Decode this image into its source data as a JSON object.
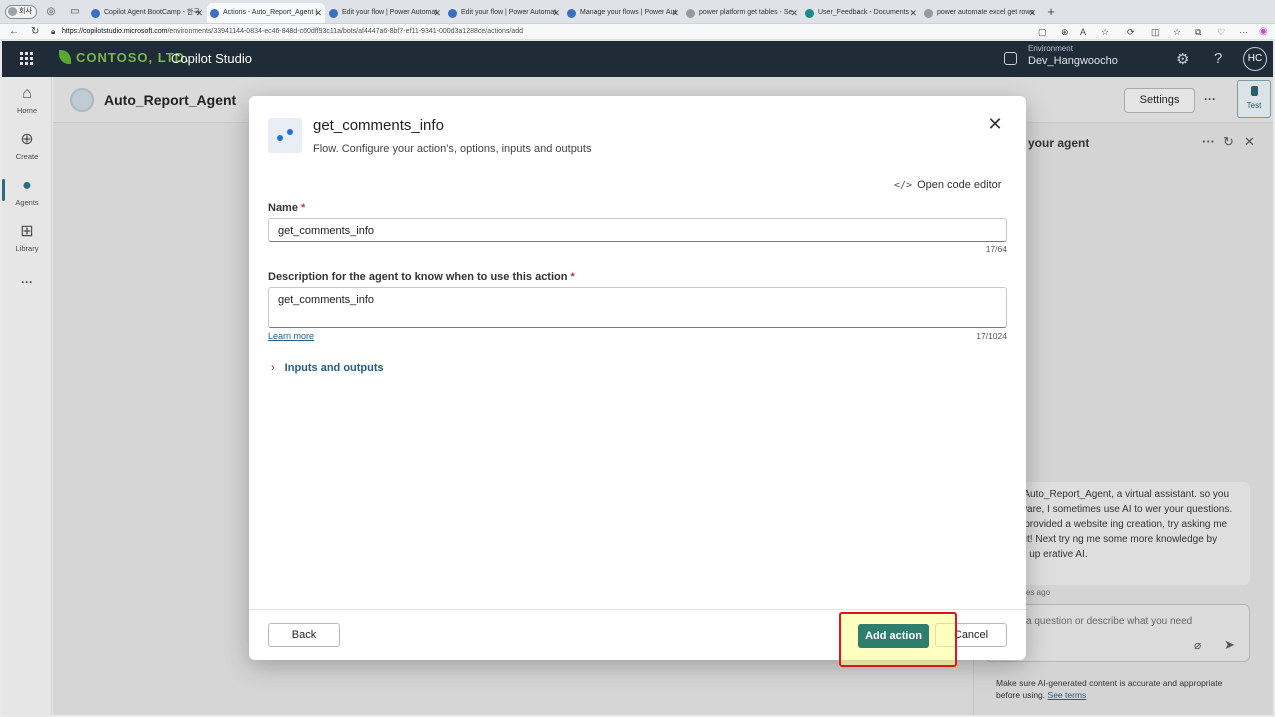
{
  "browser": {
    "profile_label": "회사",
    "tabs": [
      {
        "label": "Copilot Agent BootCamp - 한국"
      },
      {
        "label": "Actions - Auto_Report_Agent | "
      },
      {
        "label": "Edit your flow | Power Automat"
      },
      {
        "label": "Edit your flow | Power Automat"
      },
      {
        "label": "Manage your flows | Power Aut"
      },
      {
        "label": "power platform get tables - Se"
      },
      {
        "label": "User_Feedback - Documents - "
      },
      {
        "label": "power automate excel get rows"
      }
    ],
    "url_host": "https://copilotstudio.microsoft.com",
    "url_path": "/environments/33941144-0834-ec46-848d-c60dff93c11a/bots/af4447a6-8bf7-ef11-9341-000d3a1288ce/actions/add"
  },
  "header": {
    "logo_text": "CONTOSO, LTD.",
    "app_name": "Copilot Studio",
    "environment_label": "Environment",
    "environment_name": "Dev_Hangwoocho",
    "avatar_initials": "HC"
  },
  "rail": {
    "items": [
      {
        "label": "Home",
        "icon": "home-icon"
      },
      {
        "label": "Create",
        "icon": "plus-circle-icon"
      },
      {
        "label": "Agents",
        "icon": "agents-icon"
      },
      {
        "label": "Library",
        "icon": "library-icon"
      }
    ],
    "more": "···"
  },
  "page": {
    "agent_name": "Auto_Report_Agent",
    "settings_label": "Settings",
    "test_label": "Test",
    "more": "···"
  },
  "test_pane": {
    "title": "your agent",
    "message": "o, I'm Auto_Report_Agent, a virtual assistant. so you are aware, I sometimes use AI to wer your questions. If you provided a website ing creation, try asking me about it! Next try ng me some more knowledge by setting up erative AI.",
    "time": "es ago",
    "placeholder": "a question or describe what you need",
    "disclaimer": "Make sure AI-generated content is accurate and appropriate before using.",
    "see_terms": "See terms"
  },
  "modal": {
    "title": "get_comments_info",
    "subtitle": "Flow. Configure your action's, options, inputs and outputs",
    "open_code_editor": "Open code editor",
    "name_label": "Name",
    "name_value": "get_comments_info",
    "name_counter": "17/64",
    "desc_label": "Description for the agent to know when to use this action",
    "desc_value": "get_comments_info",
    "desc_counter": "17/1024",
    "learn_more": "Learn more",
    "inputs_outputs": "Inputs and outputs",
    "back_label": "Back",
    "add_label": "Add action",
    "cancel_label": "Cancel",
    "required_mark": "*"
  },
  "colors": {
    "header_bg": "#1f2b36",
    "primary_button": "#2f7d6d",
    "highlight_border": "#e0141e",
    "link": "#245d8a"
  }
}
